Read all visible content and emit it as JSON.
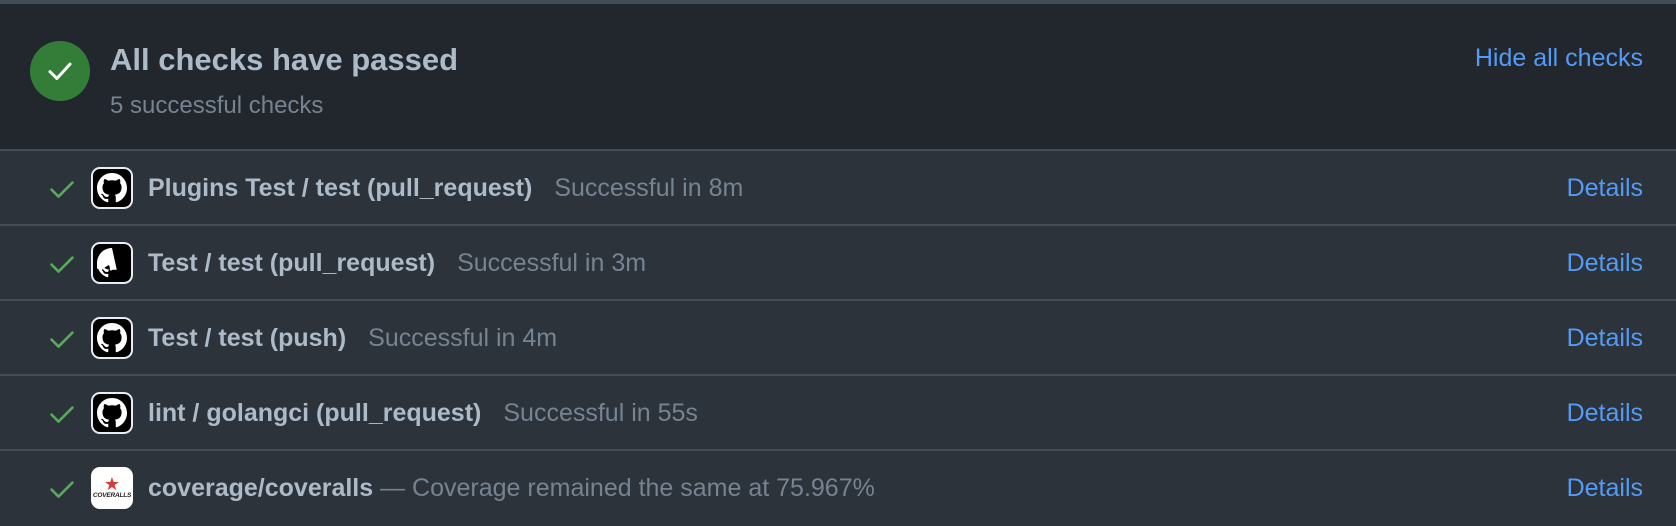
{
  "summary": {
    "title": "All checks have passed",
    "subtitle": "5 successful checks",
    "hide_label": "Hide all checks",
    "status_color": "#347d39"
  },
  "checks": [
    {
      "name": "Plugins Test / test (pull_request)",
      "status": "Successful in 8m",
      "app_icon": "github-icon",
      "details_label": "Details"
    },
    {
      "name": "Test / test (pull_request)",
      "status": "Successful in 3m",
      "app_icon": "github-icon",
      "details_label": "Details"
    },
    {
      "name": "Test / test (push)",
      "status": "Successful in 4m",
      "app_icon": "github-icon",
      "details_label": "Details"
    },
    {
      "name": "lint / golangci (pull_request)",
      "status": "Successful in 55s",
      "app_icon": "github-icon",
      "details_label": "Details"
    },
    {
      "name": "coverage/coveralls",
      "description": "— Coverage remained the same at 75.967%",
      "app_icon": "coveralls-logo",
      "app_logo_text": "COVERALLS",
      "details_label": "Details"
    }
  ],
  "colors": {
    "success": "#57ab5a",
    "link": "#539bf5",
    "text_primary": "#adbac7",
    "text_muted": "#768390"
  }
}
